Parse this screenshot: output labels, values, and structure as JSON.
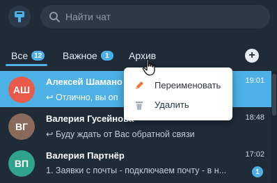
{
  "search": {
    "placeholder": "Найти чат"
  },
  "tabs": [
    {
      "label": "Все",
      "badge": "12"
    },
    {
      "label": "Важное",
      "badge": "1"
    },
    {
      "label": "Архив"
    }
  ],
  "add_button": "+",
  "context_menu": {
    "items": [
      {
        "label": "Переименовать",
        "icon": "pencil-icon"
      },
      {
        "label": "Удалить",
        "icon": "trash-icon"
      }
    ]
  },
  "chats": [
    {
      "initials": "АШ",
      "name": "Алексей Шамано",
      "time": "19:01",
      "preview": "↩ Отличнo, вы оп",
      "avatar_color": "#e85a4a",
      "selected": true
    },
    {
      "initials": "ВГ",
      "name": "Валерия Гусейнова",
      "time": "18:48",
      "preview": "↩ Буду ждать от Вас обратной связи",
      "avatar_color": "#8a6a5a"
    },
    {
      "initials": "ВП",
      "name": "Валерия Партнёр",
      "time": "17:02",
      "preview": "1. Заявки с почты - подключаем почту - в н...",
      "avatar_color": "#2fa48a",
      "unread": "1"
    }
  ],
  "colors": {
    "accent": "#4db1e6",
    "background": "#1f2c38"
  }
}
